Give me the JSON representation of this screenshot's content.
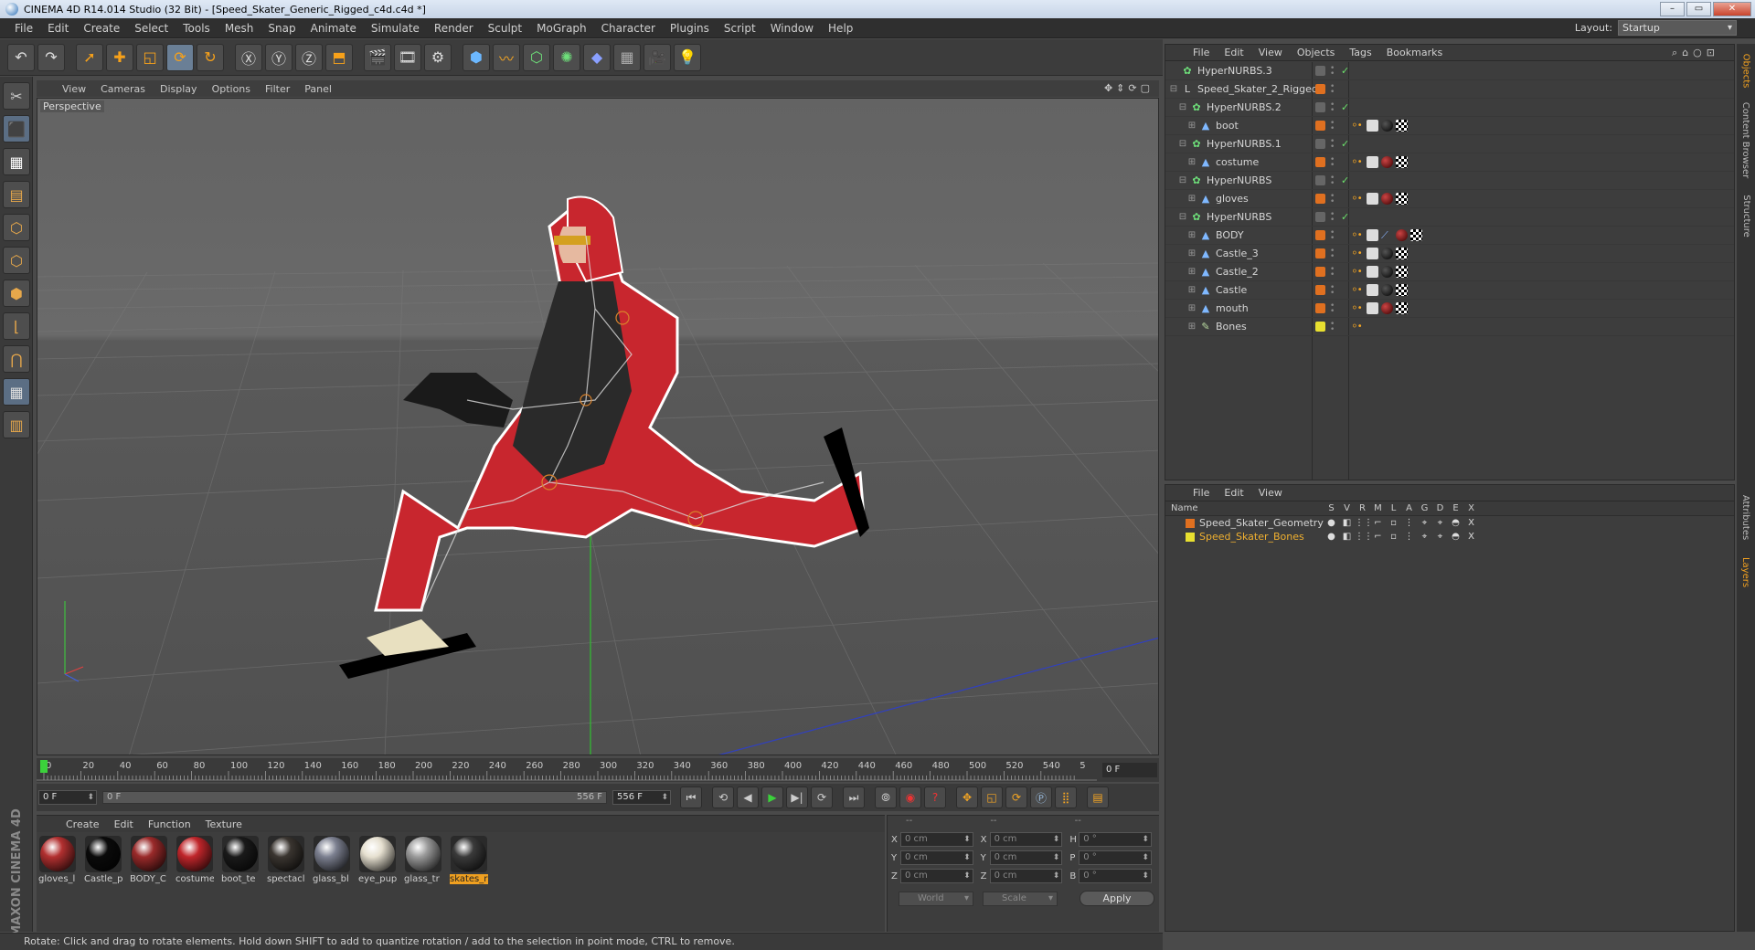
{
  "window": {
    "title": "CINEMA 4D R14.014 Studio (32 Bit) - [Speed_Skater_Generic_Rigged_c4d.c4d *]",
    "controls": [
      "–",
      "▭",
      "✕"
    ]
  },
  "menubar": {
    "items": [
      "File",
      "Edit",
      "Create",
      "Select",
      "Tools",
      "Mesh",
      "Snap",
      "Animate",
      "Simulate",
      "Render",
      "Sculpt",
      "MoGraph",
      "Character",
      "Plugins",
      "Script",
      "Window",
      "Help"
    ],
    "layout_label": "Layout:",
    "layout_value": "Startup"
  },
  "viewport": {
    "menu": [
      "View",
      "Cameras",
      "Display",
      "Options",
      "Filter",
      "Panel"
    ],
    "label": "Perspective"
  },
  "timeline": {
    "ticks": [
      "0",
      "20",
      "40",
      "60",
      "80",
      "100",
      "120",
      "140",
      "160",
      "180",
      "200",
      "220",
      "240",
      "260",
      "280",
      "300",
      "320",
      "340",
      "360",
      "380",
      "400",
      "420",
      "440",
      "460",
      "480",
      "500",
      "520",
      "540",
      "5"
    ],
    "current_frame": "0 F",
    "start_field": "0 F",
    "range_start": "0 F",
    "range_end": "556 F",
    "end_field": "556 F"
  },
  "material_manager": {
    "menu": [
      "Create",
      "Edit",
      "Function",
      "Texture"
    ],
    "materials": [
      {
        "label": "gloves_l",
        "color": "#b23030"
      },
      {
        "label": "Castle_p",
        "color": "#0a0a0a"
      },
      {
        "label": "BODY_C",
        "color": "#9a2a2a"
      },
      {
        "label": "costume",
        "color": "#c0262b"
      },
      {
        "label": "boot_te",
        "color": "#1a1a1a"
      },
      {
        "label": "spectacl",
        "color": "#3a3530"
      },
      {
        "label": "glass_bl",
        "color": "#7c8090"
      },
      {
        "label": "eye_pup",
        "color": "#e6e0d0"
      },
      {
        "label": "glass_tr",
        "color": "#9a9a9a"
      },
      {
        "label": "skates_r",
        "color": "#3a3a3a"
      }
    ]
  },
  "coordinates": {
    "headers": [
      "--",
      "--",
      "--"
    ],
    "rows": [
      {
        "pos_axis": "X",
        "pos": "0 cm",
        "size_axis": "X",
        "size": "0 cm",
        "rot_axis": "H",
        "rot": "0 °"
      },
      {
        "pos_axis": "Y",
        "pos": "0 cm",
        "size_axis": "Y",
        "size": "0 cm",
        "rot_axis": "P",
        "rot": "0 °"
      },
      {
        "pos_axis": "Z",
        "pos": "0 cm",
        "size_axis": "Z",
        "size": "0 cm",
        "rot_axis": "B",
        "rot": "0 °"
      }
    ],
    "world": "World",
    "scale": "Scale",
    "apply": "Apply"
  },
  "status": "Rotate: Click and drag to rotate elements. Hold down SHIFT to add to quantize rotation / add to the selection in point mode, CTRL to remove.",
  "object_manager": {
    "menu": [
      "File",
      "Edit",
      "View",
      "Objects",
      "Tags",
      "Bookmarks"
    ],
    "objects": [
      {
        "name": "HyperNURBS.3",
        "tree": "",
        "icon": "✿",
        "kind": "nurbs",
        "indent": 0,
        "layer": "#666",
        "check": "✓",
        "tags": []
      },
      {
        "name": "Speed_Skater_2_Rigged",
        "tree": "⊟",
        "icon": "L",
        "kind": "null",
        "indent": 0,
        "layer": "#e07020",
        "check": "",
        "tags": []
      },
      {
        "name": "HyperNURBS.2",
        "tree": "⊟",
        "icon": "✿",
        "kind": "nurbs",
        "indent": 1,
        "layer": "#666",
        "check": "✓",
        "tags": []
      },
      {
        "name": "boot",
        "tree": "⊞",
        "icon": "▲",
        "kind": "poly",
        "indent": 2,
        "layer": "#e07020",
        "check": "",
        "tags": [
          "ik",
          "uvw",
          "mat-dark",
          "checker"
        ]
      },
      {
        "name": "HyperNURBS.1",
        "tree": "⊟",
        "icon": "✿",
        "kind": "nurbs",
        "indent": 1,
        "layer": "#666",
        "check": "✓",
        "tags": []
      },
      {
        "name": "costume",
        "tree": "⊞",
        "icon": "▲",
        "kind": "poly",
        "indent": 2,
        "layer": "#e07020",
        "check": "",
        "tags": [
          "ik",
          "uvw",
          "mat-red",
          "checker"
        ]
      },
      {
        "name": "HyperNURBS",
        "tree": "⊟",
        "icon": "✿",
        "kind": "nurbs",
        "indent": 1,
        "layer": "#666",
        "check": "✓",
        "tags": []
      },
      {
        "name": "gloves",
        "tree": "⊞",
        "icon": "▲",
        "kind": "poly",
        "indent": 2,
        "layer": "#e07020",
        "check": "",
        "tags": [
          "ik",
          "uvw",
          "mat-red",
          "checker"
        ]
      },
      {
        "name": "HyperNURBS",
        "tree": "⊟",
        "icon": "✿",
        "kind": "nurbs",
        "indent": 1,
        "layer": "#666",
        "check": "✓",
        "tags": []
      },
      {
        "name": "BODY",
        "tree": "⊞",
        "icon": "▲",
        "kind": "poly",
        "indent": 2,
        "layer": "#e07020",
        "check": "",
        "tags": [
          "ik",
          "uvw",
          "blue",
          "mat-red",
          "checker"
        ]
      },
      {
        "name": "Castle_3",
        "tree": "⊞",
        "icon": "▲",
        "kind": "poly",
        "indent": 2,
        "layer": "#e07020",
        "check": "",
        "tags": [
          "ik",
          "uvw",
          "mat-dark",
          "checker"
        ]
      },
      {
        "name": "Castle_2",
        "tree": "⊞",
        "icon": "▲",
        "kind": "poly",
        "indent": 2,
        "layer": "#e07020",
        "check": "",
        "tags": [
          "ik",
          "uvw",
          "mat-dark",
          "checker"
        ]
      },
      {
        "name": "Castle",
        "tree": "⊞",
        "icon": "▲",
        "kind": "poly",
        "indent": 2,
        "layer": "#e07020",
        "check": "",
        "tags": [
          "ik",
          "uvw",
          "mat-dark",
          "checker"
        ]
      },
      {
        "name": "mouth",
        "tree": "⊞",
        "icon": "▲",
        "kind": "poly",
        "indent": 2,
        "layer": "#e07020",
        "check": "",
        "tags": [
          "ik",
          "uvw",
          "mat-red",
          "checker"
        ]
      },
      {
        "name": "Bones",
        "tree": "⊞",
        "icon": "✎",
        "kind": "bone",
        "indent": 2,
        "layer": "#e8e030",
        "check": "",
        "tags": [
          "ik"
        ]
      }
    ]
  },
  "right_tabs": [
    "Objects",
    "Content Browser",
    "Structure",
    "Attributes",
    "Layers"
  ],
  "layer_manager": {
    "menu": [
      "File",
      "Edit",
      "View"
    ],
    "name_header": "Name",
    "col_headers": [
      "S",
      "V",
      "R",
      "M",
      "L",
      "A",
      "G",
      "D",
      "E",
      "X"
    ],
    "layers": [
      {
        "name": "Speed_Skater_Geometry",
        "color": "#e07020",
        "highlight": false
      },
      {
        "name": "Speed_Skater_Bones",
        "color": "#e8e030",
        "highlight": true
      }
    ]
  },
  "colors": {
    "accent_orange": "#f0a020",
    "panel_bg": "#3d3d3d",
    "viewport_bg": "#5e5e5e",
    "costume_red": "#c8262e"
  }
}
